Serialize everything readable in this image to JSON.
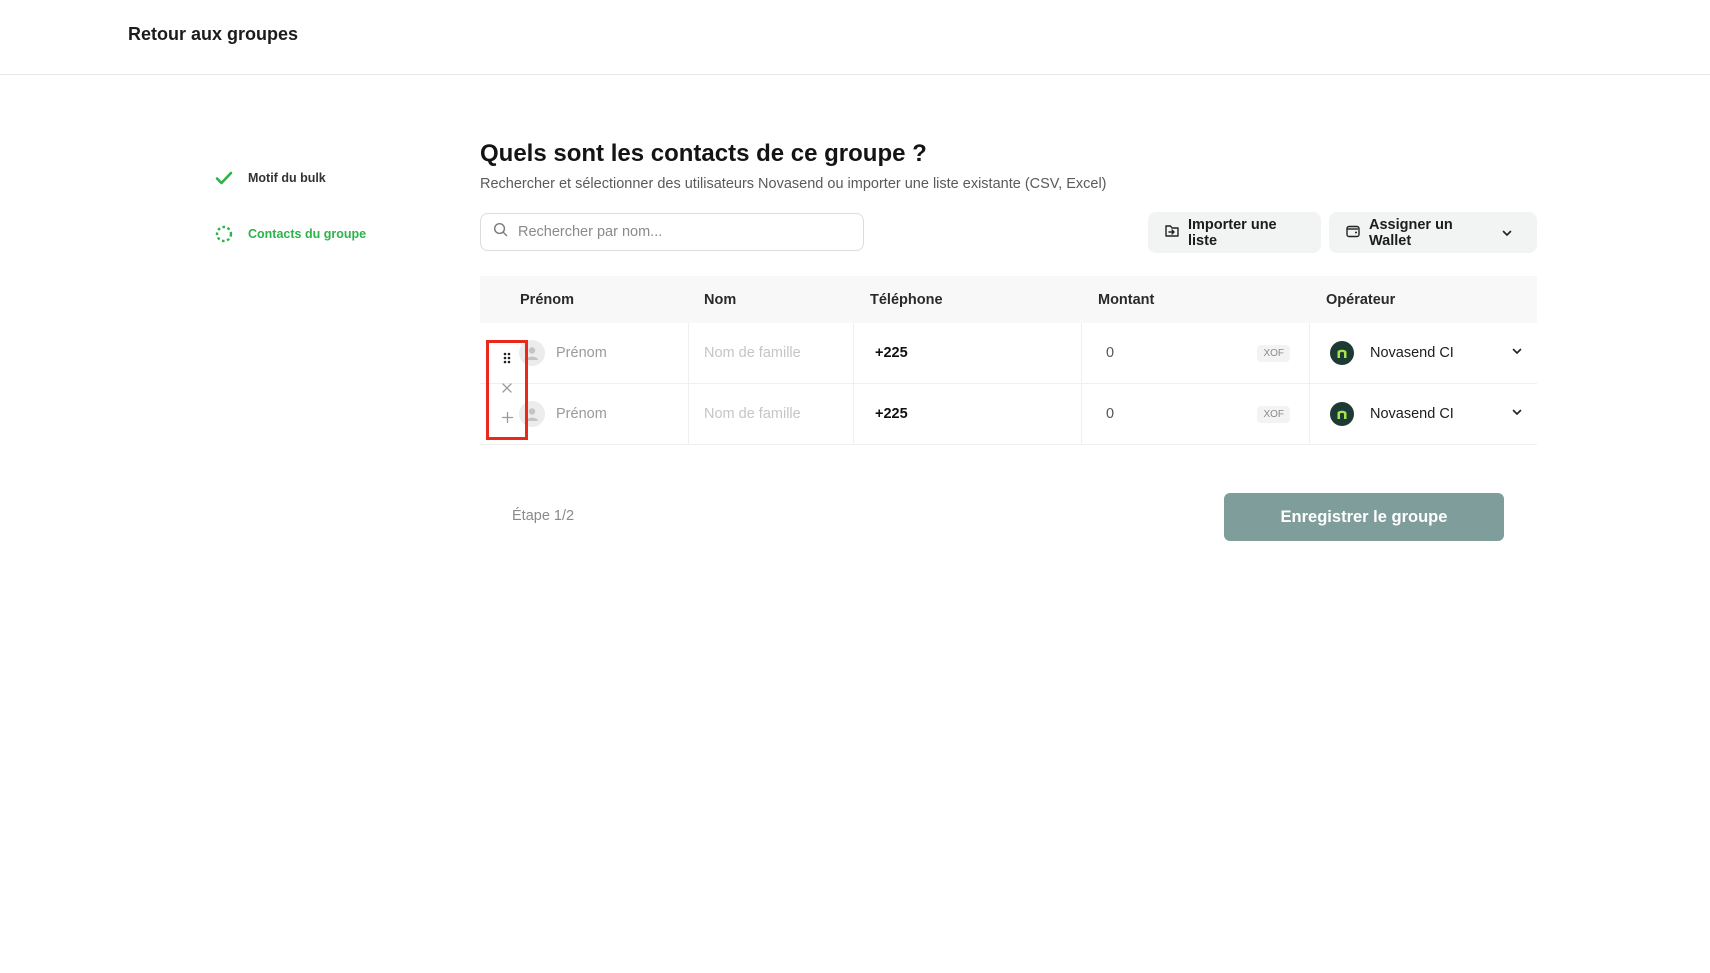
{
  "header": {
    "back_label": "Retour aux groupes"
  },
  "steps": [
    {
      "label": "Motif du bulk",
      "state": "done"
    },
    {
      "label": "Contacts du groupe",
      "state": "active"
    }
  ],
  "main": {
    "title": "Quels sont les contacts de ce groupe ?",
    "subtitle": "Rechercher et sélectionner des utilisateurs Novasend ou importer une liste existante (CSV, Excel)",
    "search_placeholder": "Rechercher par nom...",
    "import_label": "Importer une liste",
    "wallet_label": "Assigner un Wallet"
  },
  "table": {
    "columns": [
      "Prénom",
      "Nom",
      "Téléphone",
      "Montant",
      "Opérateur"
    ],
    "rows": [
      {
        "first_name_placeholder": "Prénom",
        "last_name_placeholder": "Nom de famille",
        "phone": "+225",
        "amount": "0",
        "currency": "XOF",
        "operator": "Novasend CI"
      },
      {
        "first_name_placeholder": "Prénom",
        "last_name_placeholder": "Nom de famille",
        "phone": "+225",
        "amount": "0",
        "currency": "XOF",
        "operator": "Novasend CI"
      }
    ]
  },
  "footer": {
    "step_label": "Étape 1/2",
    "save_label": "Enregistrer le groupe"
  },
  "colors": {
    "accent_green": "#2cb34a",
    "save_button": "#7f9e9b",
    "highlight_box": "#e8291c",
    "operator_logo_bg": "#1e3a34",
    "operator_logo_fg": "#a6e34a"
  },
  "icons": {
    "step_done": "check-icon",
    "step_active": "dashed-circle-icon",
    "search": "search-icon",
    "import": "import-file-icon",
    "wallet": "wallet-icon",
    "drag": "drag-handle-icon",
    "remove": "close-icon",
    "add": "plus-icon"
  }
}
